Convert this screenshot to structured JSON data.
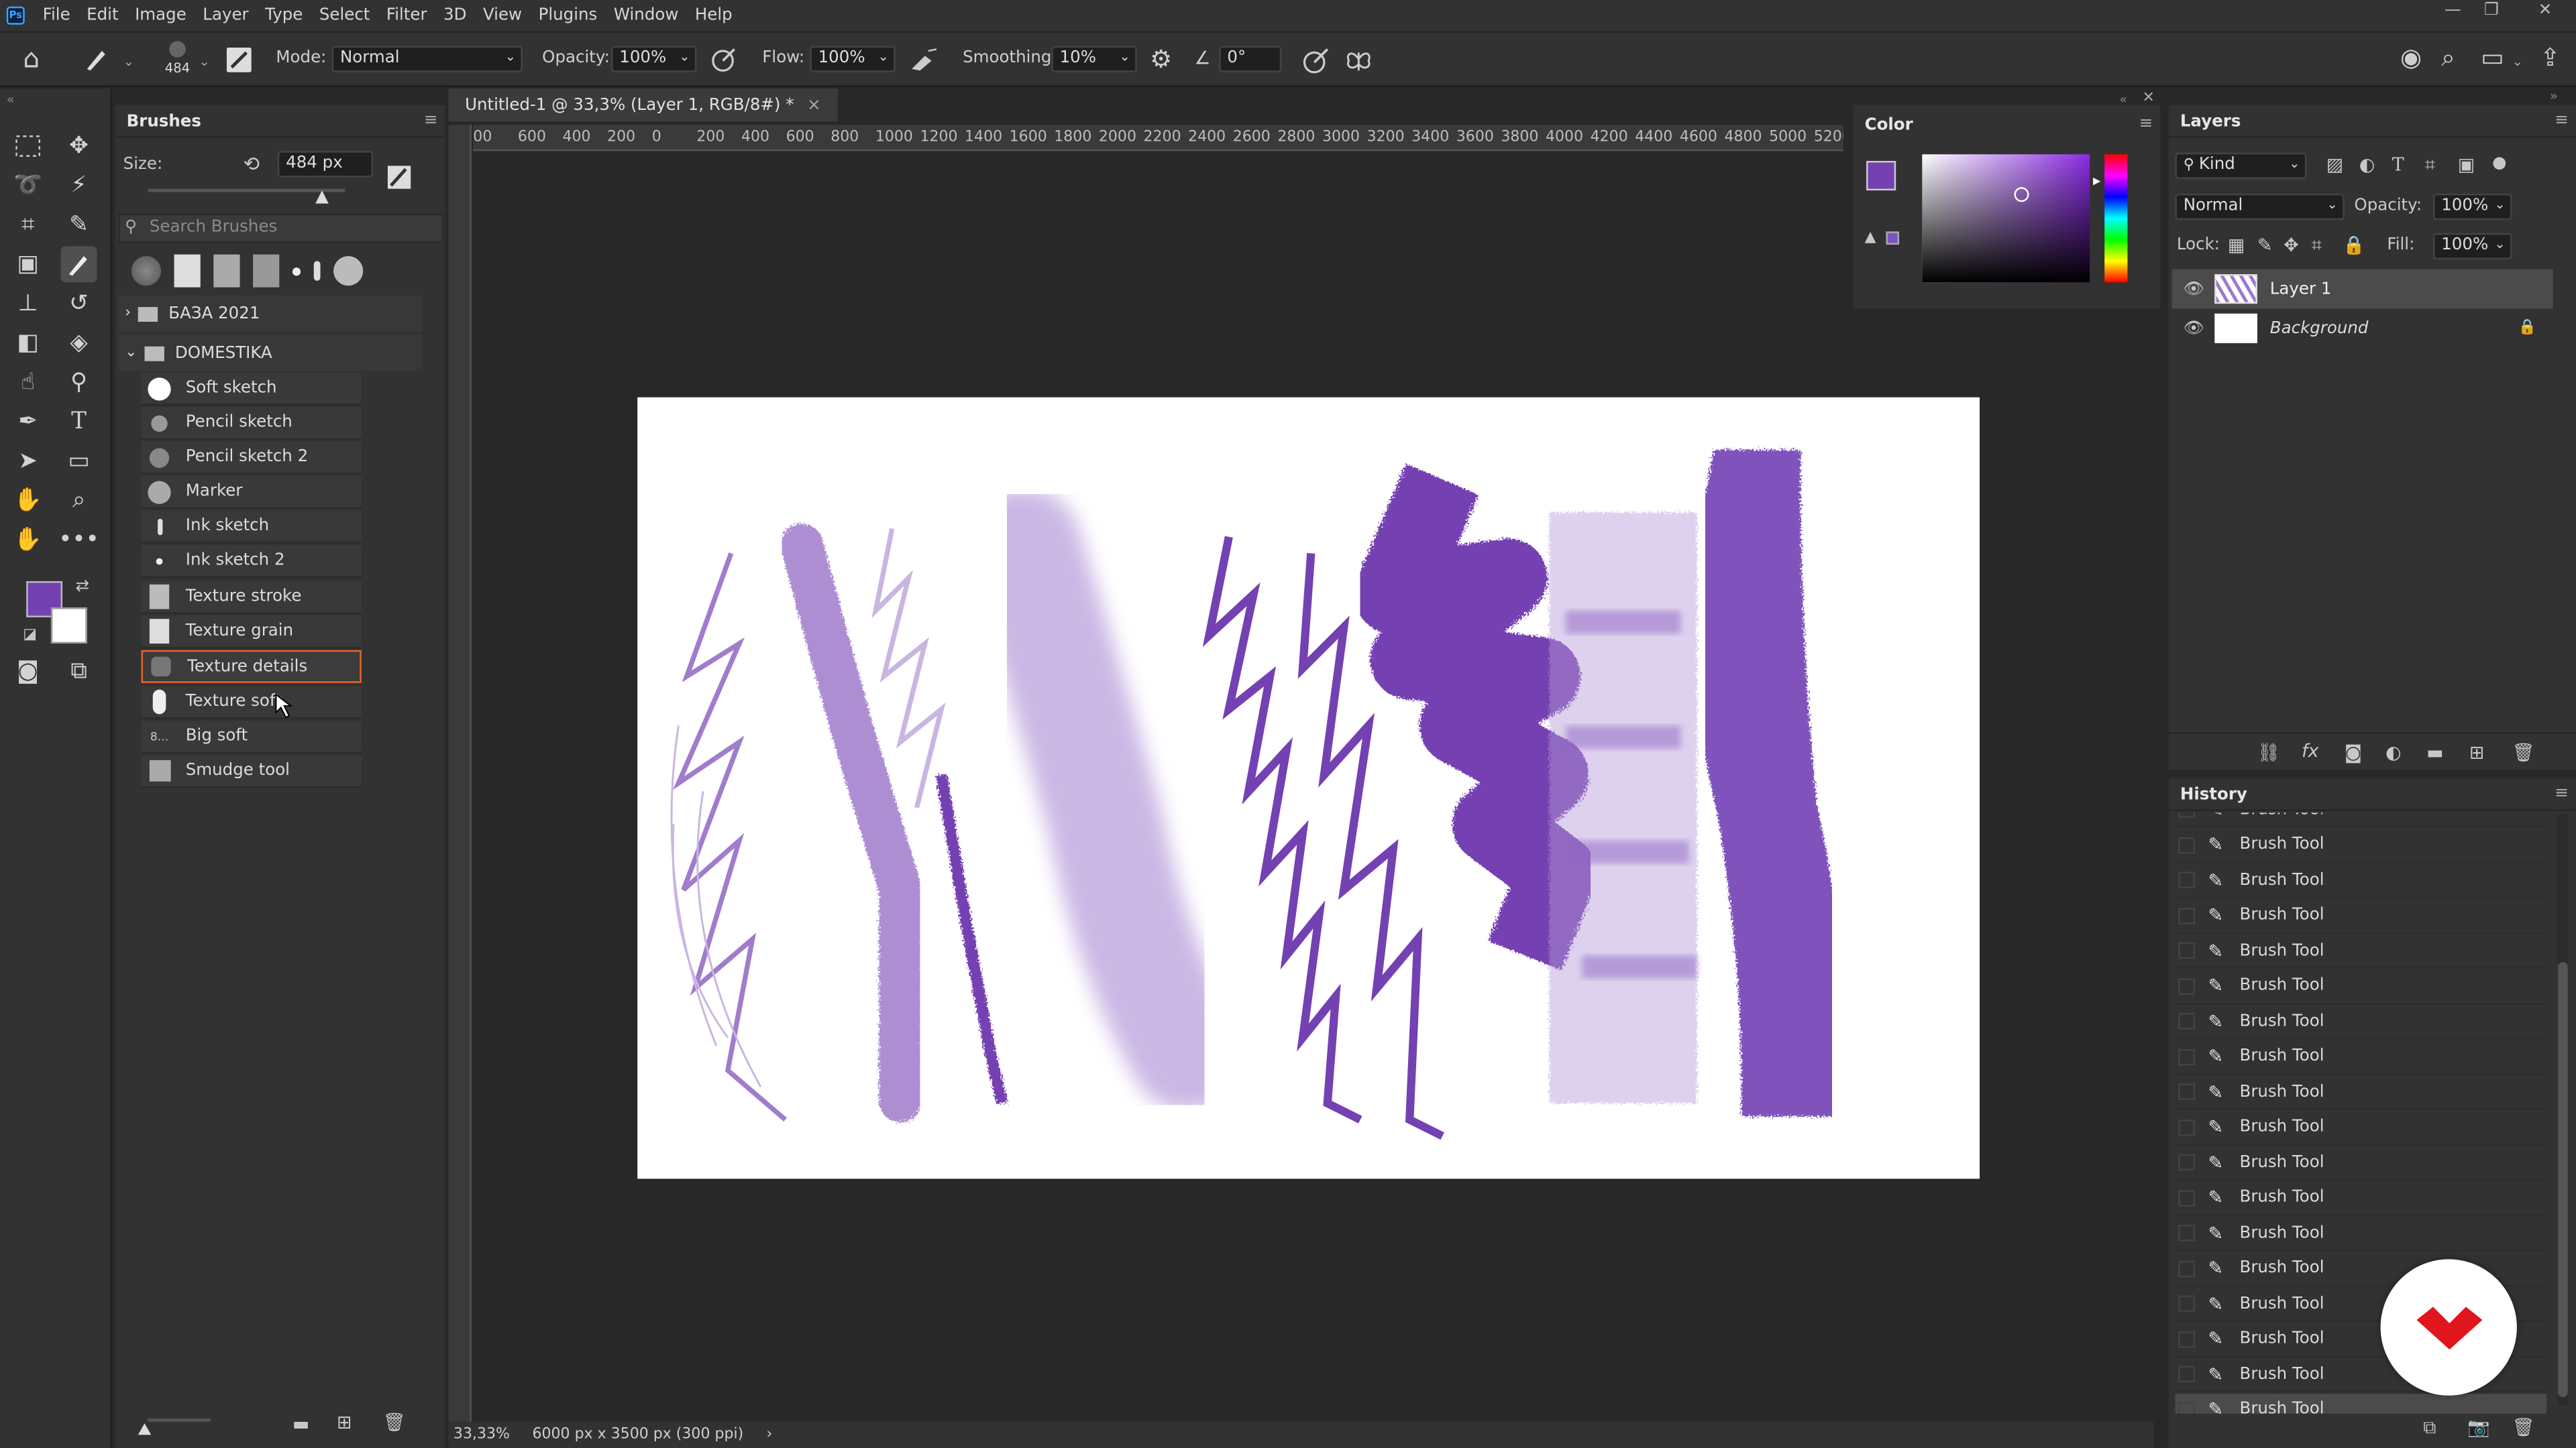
{
  "menu": [
    "File",
    "Edit",
    "Image",
    "Layer",
    "Type",
    "Select",
    "Filter",
    "3D",
    "View",
    "Plugins",
    "Window",
    "Help"
  ],
  "options": {
    "brush_size": "484",
    "mode_label": "Mode:",
    "mode_value": "Normal",
    "opacity_label": "Opacity:",
    "opacity_value": "100%",
    "flow_label": "Flow:",
    "flow_value": "100%",
    "smoothing_label": "Smoothing:",
    "smoothing_value": "10%",
    "angle_value": "0°"
  },
  "brushes": {
    "title": "Brushes",
    "size_label": "Size:",
    "size_value": "484 px",
    "search_placeholder": "Search Brushes",
    "groups": [
      "БАЗА 2021",
      "DOMESTIKA"
    ],
    "items": [
      "Soft sketch",
      "Pencil sketch",
      "Pencil sketch 2",
      "Marker",
      "Ink sketch",
      "Ink sketch 2",
      "Texture stroke",
      "Texture grain",
      "Texture details",
      "Texture soft",
      "Big soft",
      "Smudge tool"
    ],
    "selected": "Texture details",
    "big_soft_number": "8..."
  },
  "document": {
    "tab_title": "Untitled-1 @ 33,3% (Layer 1, RGB/8#) *",
    "ruler_labels": [
      "00",
      "600",
      "400",
      "200",
      "0",
      "200",
      "400",
      "600",
      "800",
      "1000",
      "1200",
      "1400",
      "1600",
      "1800",
      "2000",
      "2200",
      "2400",
      "2600",
      "2800",
      "3000",
      "3200",
      "3400",
      "3600",
      "3800",
      "4000",
      "4200",
      "4400",
      "4600",
      "4800",
      "5000",
      "5200"
    ],
    "zoom": "33,33%",
    "doc_info": "6000 px x 3500 px (300 ppi)"
  },
  "color_panel": {
    "title": "Color",
    "foreground": "#7441b2",
    "background": "#ffffff"
  },
  "layers_panel": {
    "title": "Layers",
    "filter_kind": "Kind",
    "blend_mode": "Normal",
    "opacity_label": "Opacity:",
    "opacity_value": "100%",
    "lock_label": "Lock:",
    "fill_label": "Fill:",
    "fill_value": "100%",
    "layers": [
      {
        "name": "Layer 1",
        "selected": true
      },
      {
        "name": "Background",
        "locked": true
      }
    ]
  },
  "history_panel": {
    "title": "History",
    "items": [
      "Brush Tool",
      "Brush Tool",
      "Brush Tool",
      "Brush Tool",
      "Brush Tool",
      "Brush Tool",
      "Brush Tool",
      "Brush Tool",
      "Brush Tool",
      "Brush Tool",
      "Brush Tool",
      "Brush Tool",
      "Brush Tool",
      "Brush Tool",
      "Brush Tool",
      "Brush Tool",
      "Brush Tool",
      "Brush Tool"
    ]
  },
  "colors": {
    "accent": "#7441b2",
    "selection_outline": "#e8672a",
    "logo_red": "#e0151d"
  }
}
